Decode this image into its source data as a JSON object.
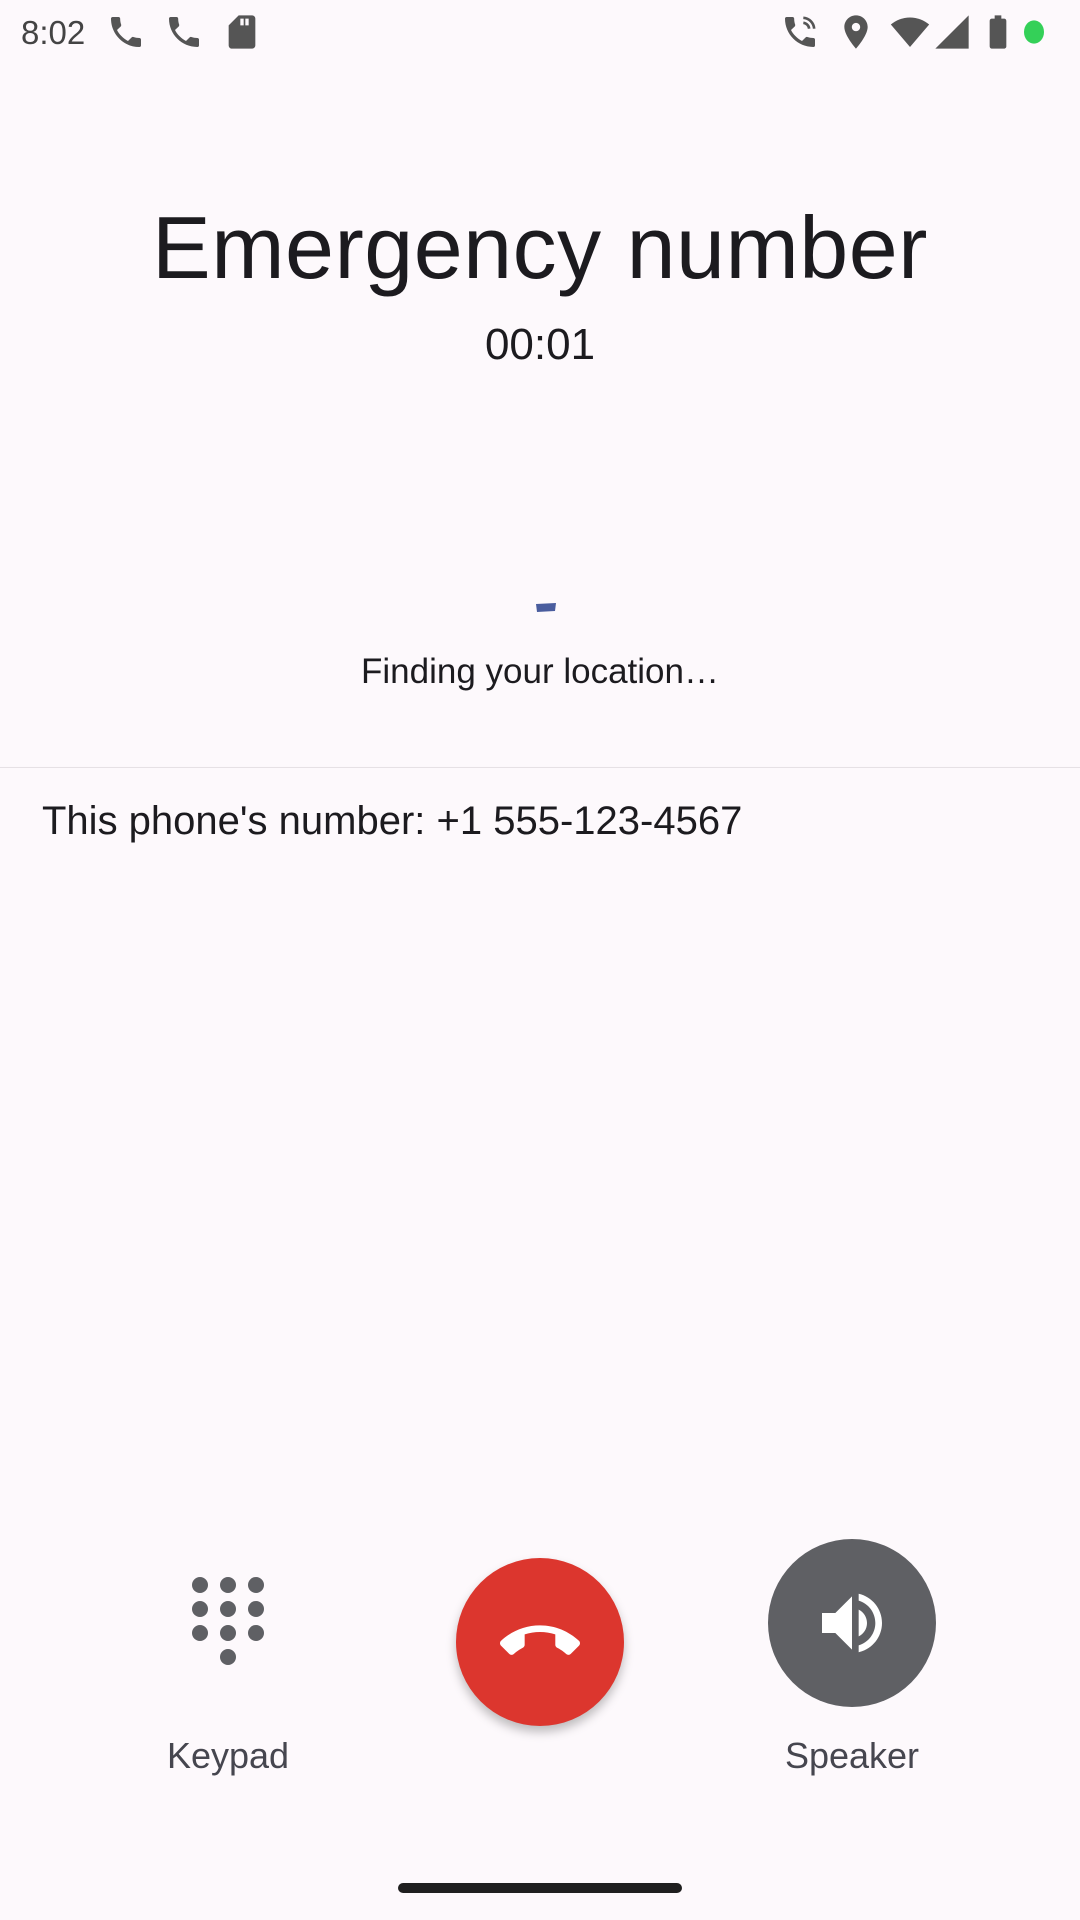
{
  "status_bar": {
    "time": "8:02",
    "left_icons": [
      "phone-icon",
      "phone-icon",
      "sim-card-icon"
    ],
    "right_icons": [
      "wifi-calling-icon",
      "location-icon",
      "wifi-icon",
      "cell-signal-icon",
      "battery-icon",
      "active-dot-icon"
    ]
  },
  "call": {
    "title": "Emergency number",
    "timer": "00:01"
  },
  "location": {
    "status": "Finding your location…"
  },
  "number_card": {
    "text": "This phone's number: +1 555-123-4567"
  },
  "controls": {
    "keypad_label": "Keypad",
    "speaker_label": "Speaker",
    "end_call_icon": "call-end-icon"
  },
  "colors": {
    "background": "#fdf9fc",
    "end_call": "#dc362e",
    "speaker_button": "#5f6064",
    "spinner": "#4a5d9e",
    "active_dot": "#34d058"
  }
}
